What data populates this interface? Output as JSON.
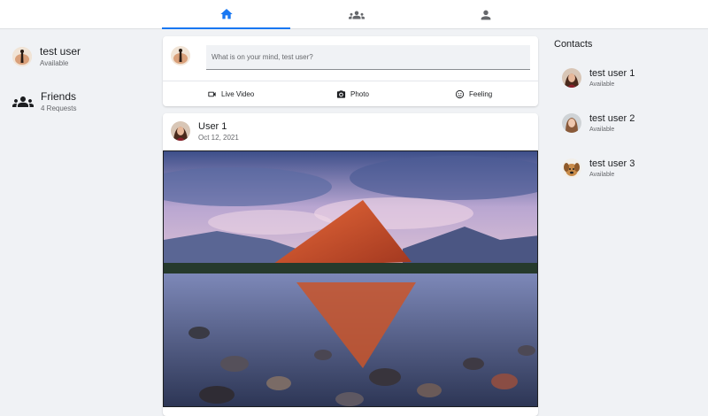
{
  "nav": {
    "tabs": [
      {
        "icon": "home-icon",
        "active": true
      },
      {
        "icon": "groups-icon",
        "active": false
      },
      {
        "icon": "profile-icon",
        "active": false
      }
    ],
    "accent": "#1877f2"
  },
  "sidebar": {
    "user": {
      "name": "test user",
      "status": "Available"
    },
    "friends": {
      "label": "Friends",
      "sub": "4 Requests"
    }
  },
  "composer": {
    "placeholder": "What is on your mind, test user?",
    "actions": [
      {
        "label": "Live Video",
        "icon": "video-camera-icon"
      },
      {
        "label": "Photo",
        "icon": "camera-icon"
      },
      {
        "label": "Feeling",
        "icon": "smiley-icon"
      }
    ]
  },
  "post": {
    "author": "User 1",
    "date": "Oct 12, 2021",
    "image": "mountain-lake-photo"
  },
  "contacts": {
    "title": "Contacts",
    "items": [
      {
        "name": "test user 1",
        "status": "Available"
      },
      {
        "name": "test user 2",
        "status": "Available"
      },
      {
        "name": "test user 3",
        "status": "Available"
      }
    ]
  }
}
